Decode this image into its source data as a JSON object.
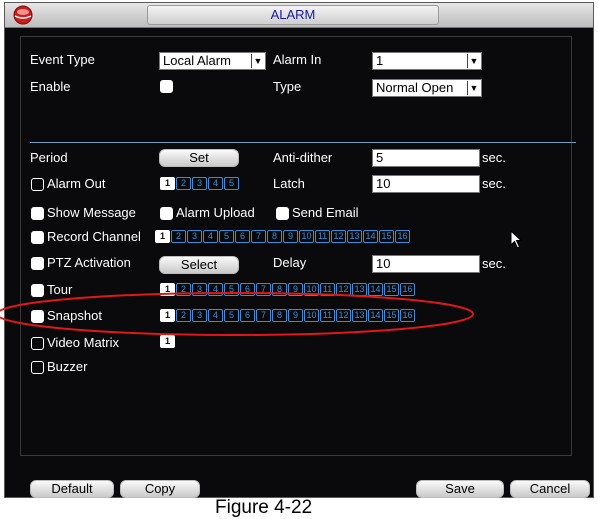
{
  "window": {
    "title": "ALARM"
  },
  "row1": {
    "event_type_label": "Event Type",
    "event_type_value": "Local Alarm",
    "alarm_in_label": "Alarm In",
    "alarm_in_value": "1"
  },
  "row2": {
    "enable_label": "Enable",
    "type_label": "Type",
    "type_value": "Normal Open"
  },
  "period": {
    "label": "Period",
    "button": "Set",
    "anti_dither_label": "Anti-dither",
    "anti_dither_value": "5",
    "unit": "sec."
  },
  "alarm_out": {
    "label": "Alarm Out",
    "channels": [
      "1",
      "2",
      "3",
      "4",
      "5"
    ],
    "selected": [
      "1"
    ],
    "latch_label": "Latch",
    "latch_value": "10",
    "unit": "sec."
  },
  "row_msg": {
    "show_message": "Show Message",
    "alarm_upload": "Alarm Upload",
    "send_email": "Send Email"
  },
  "record_channel": {
    "label": "Record Channel",
    "channels": [
      "1",
      "2",
      "3",
      "4",
      "5",
      "6",
      "7",
      "8",
      "9",
      "10",
      "11",
      "12",
      "13",
      "14",
      "15",
      "16"
    ],
    "selected": [
      "1"
    ]
  },
  "ptz": {
    "label": "PTZ Activation",
    "button": "Select",
    "delay_label": "Delay",
    "delay_value": "10",
    "unit": "sec."
  },
  "tour": {
    "label": "Tour",
    "channels": [
      "1",
      "2",
      "3",
      "4",
      "5",
      "6",
      "7",
      "8",
      "9",
      "10",
      "11",
      "12",
      "13",
      "14",
      "15",
      "16"
    ],
    "selected": [
      "1"
    ]
  },
  "snapshot": {
    "label": "Snapshot",
    "channels": [
      "1",
      "2",
      "3",
      "4",
      "5",
      "6",
      "7",
      "8",
      "9",
      "10",
      "11",
      "12",
      "13",
      "14",
      "15",
      "16"
    ],
    "selected": [
      "1"
    ]
  },
  "video_matrix": {
    "label": "Video Matrix",
    "channels": [
      "1"
    ],
    "selected": [
      "1"
    ]
  },
  "buzzer": {
    "label": "Buzzer"
  },
  "footer": {
    "default": "Default",
    "copy": "Copy",
    "save": "Save",
    "cancel": "Cancel"
  },
  "caption": "Figure 4-22",
  "colors": {
    "background": "#0a0a0c",
    "chip_border": "#3b8ed6",
    "annotation": "#e01818",
    "divider": "#7a9cc0"
  }
}
